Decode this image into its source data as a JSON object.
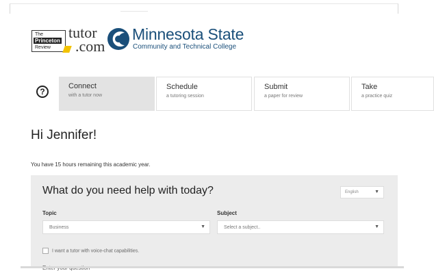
{
  "logos": {
    "princeton_review": [
      "The",
      "Princeton",
      "Review"
    ],
    "tutor_com": [
      "tutor",
      ".com"
    ],
    "college_name": "Minnesota State",
    "college_subtitle": "Community and Technical College",
    "colors": {
      "college_blue": "#1a4f7a",
      "princeton_yellow": "#f2c200"
    }
  },
  "steps": {
    "help_icon": "?",
    "items": [
      {
        "title": "Connect",
        "subtitle": "with a tutor now",
        "active": true
      },
      {
        "title": "Schedule",
        "subtitle": "a tutoring session",
        "active": false
      },
      {
        "title": "Submit",
        "subtitle": "a paper for review",
        "active": false
      },
      {
        "title": "Take",
        "subtitle": "a practice quiz",
        "active": false
      }
    ]
  },
  "greeting": "Hi Jennifer!",
  "remaining": "You have 15 hours remaining this academic year.",
  "help_form": {
    "title": "What do you need help with today?",
    "language": {
      "value": "English",
      "icon": "caret-down-icon"
    },
    "topic": {
      "label": "Topic",
      "value": "Business"
    },
    "subject": {
      "label": "Subject",
      "placeholder": "Select a subject.."
    },
    "voice_checkbox_label": "I want a tutor with voice-chat capabilities.",
    "question_label": "Enter your question"
  }
}
